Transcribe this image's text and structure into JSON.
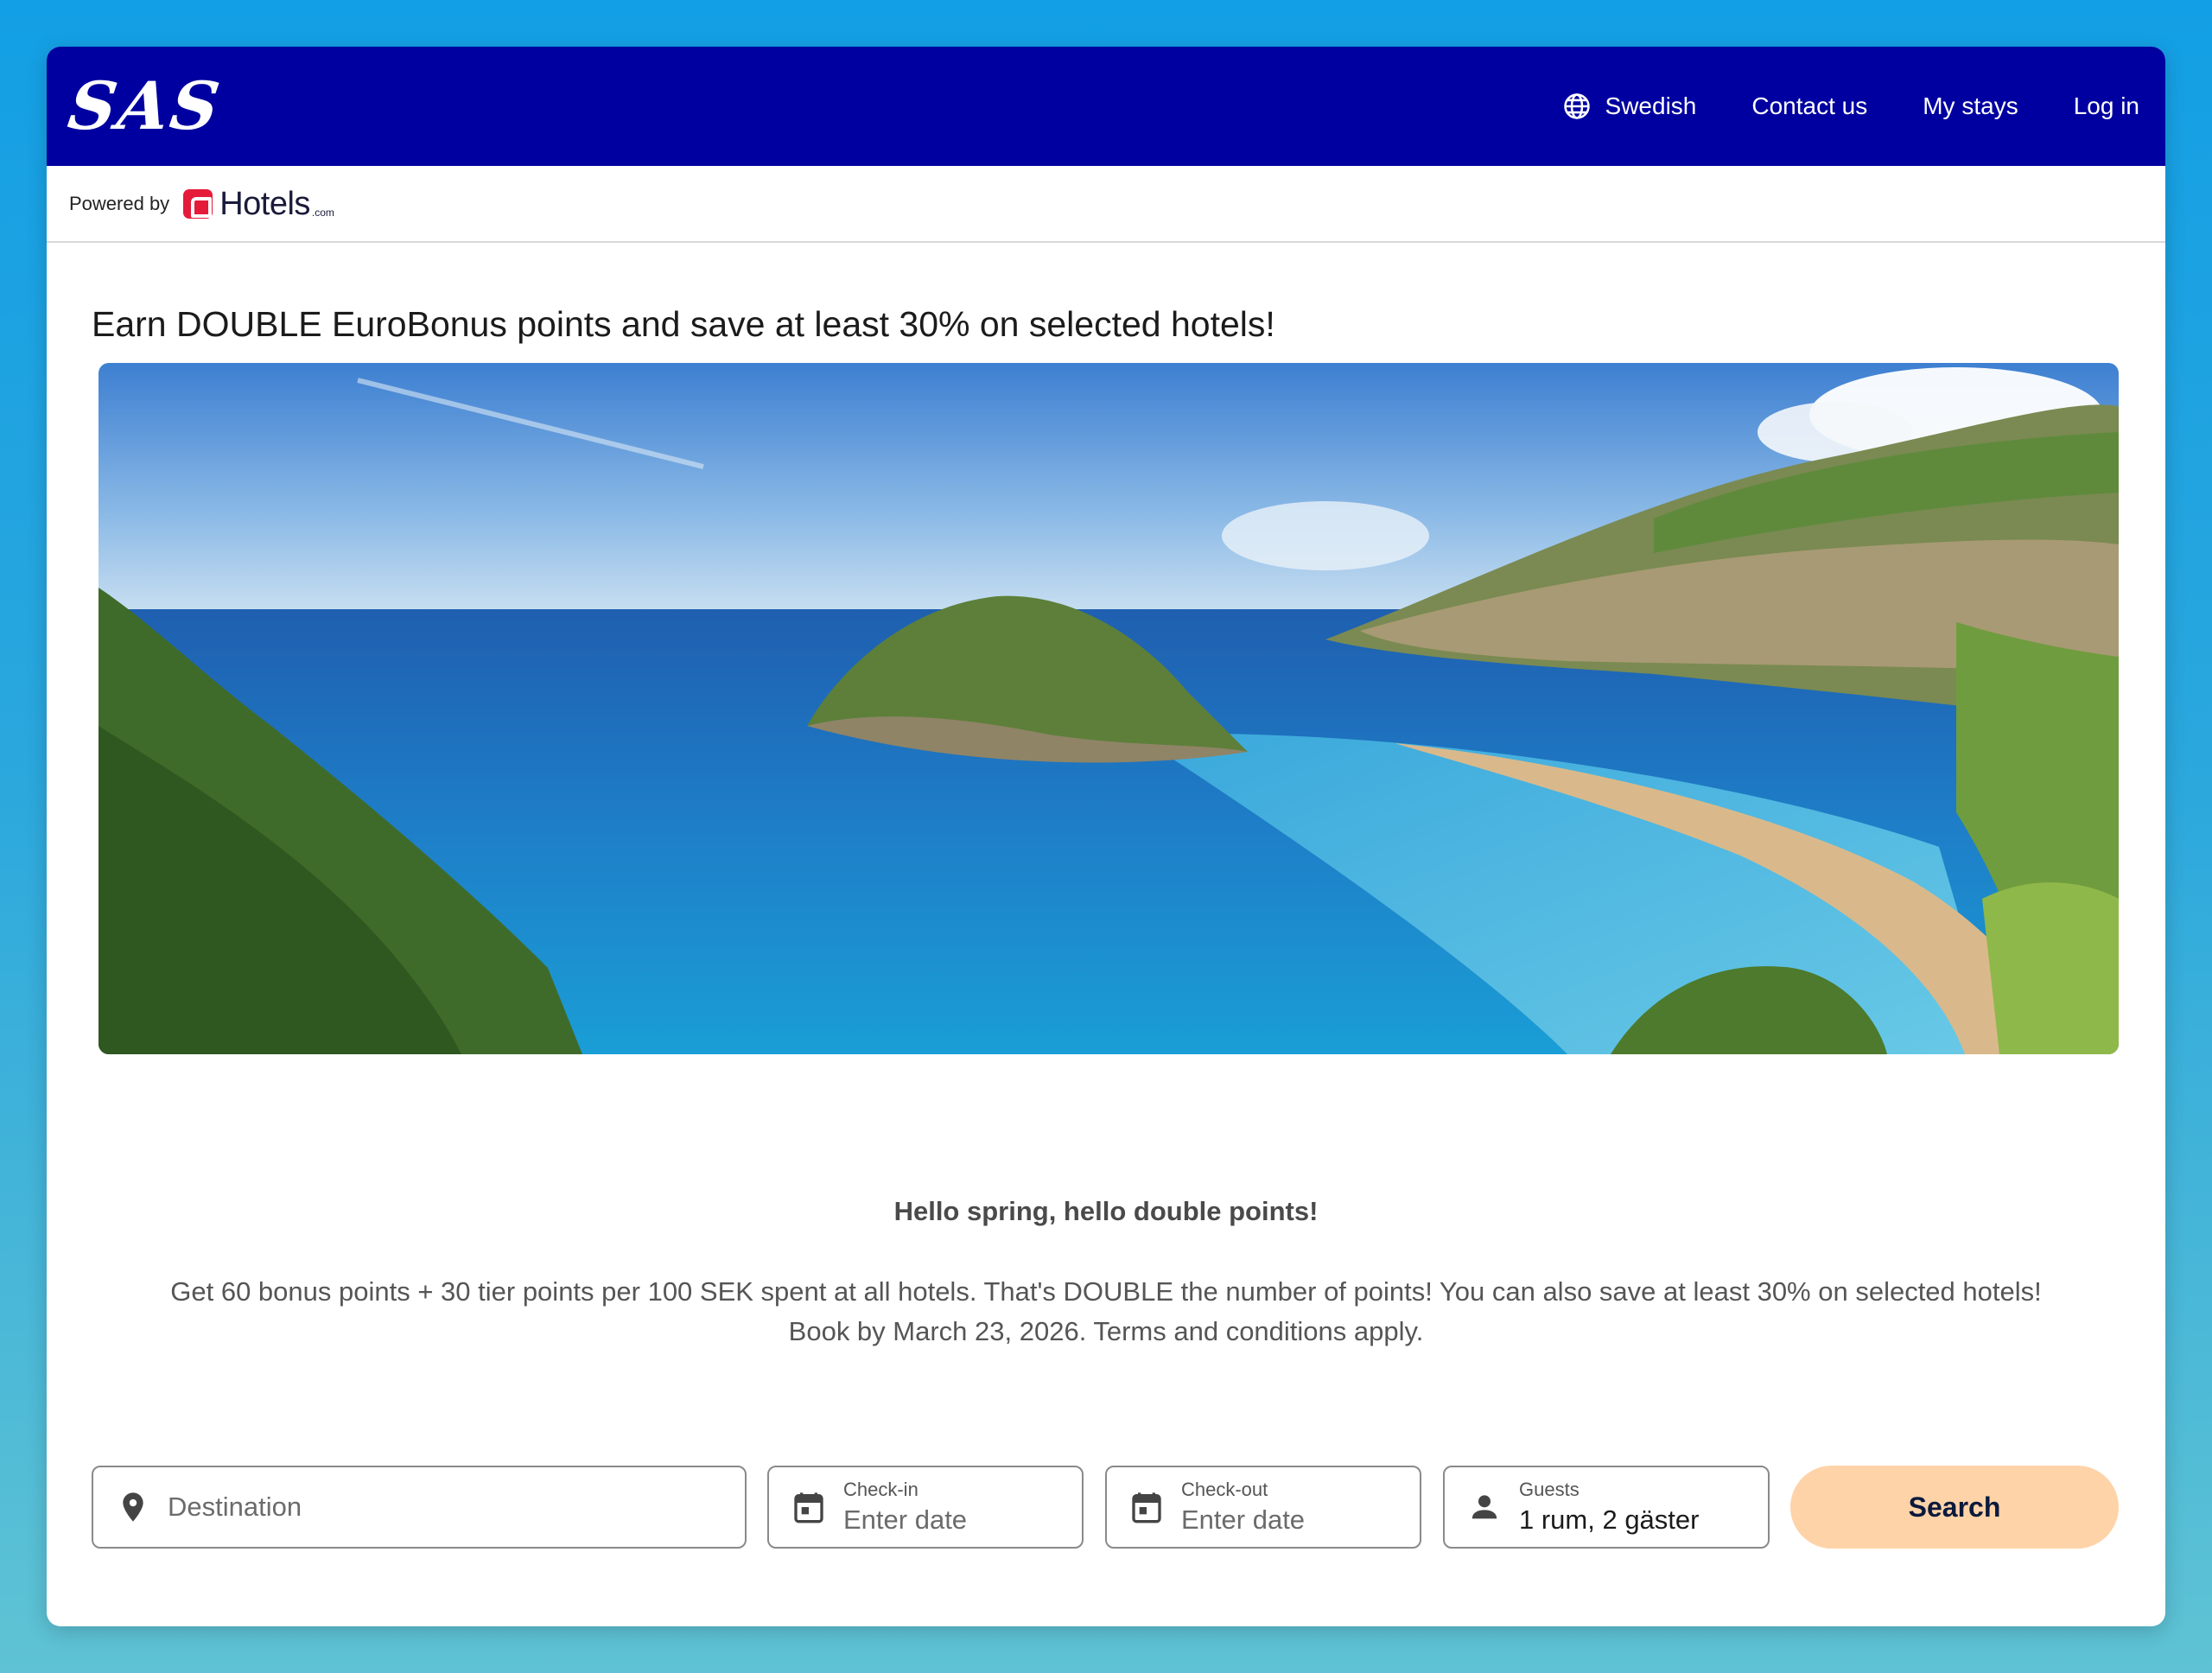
{
  "header": {
    "logo_text": "SAS",
    "nav": {
      "language": "Swedish",
      "contact": "Contact us",
      "stays": "My stays",
      "login": "Log in"
    }
  },
  "powered": {
    "label": "Powered by",
    "brand": "Hotels",
    "brand_suffix": ".com"
  },
  "main": {
    "headline": "Earn DOUBLE EuroBonus points and save at least 30% on selected hotels!",
    "hero_image": "coastal-bay-island-beach-photo",
    "promo_title": "Hello spring, hello double points!",
    "promo_line1": "Get 60 bonus points + 30 tier points per 100 SEK spent at all hotels. That's DOUBLE the number of points! You can also save at least 30% on selected hotels!",
    "promo_line2": "Book by March 23, 2026. Terms and conditions apply."
  },
  "search": {
    "destination": {
      "placeholder": "Destination",
      "icon": "location-pin-icon"
    },
    "checkin": {
      "label": "Check-in",
      "placeholder": "Enter date",
      "icon": "calendar-icon"
    },
    "checkout": {
      "label": "Check-out",
      "placeholder": "Enter date",
      "icon": "calendar-icon"
    },
    "guests": {
      "label": "Guests",
      "value": "1 rum, 2 gäster",
      "icon": "person-icon"
    },
    "button": "Search"
  },
  "colors": {
    "header_bg": "#0000a0",
    "search_button": "#ffd3a8",
    "brand_red": "#e51b3a"
  }
}
